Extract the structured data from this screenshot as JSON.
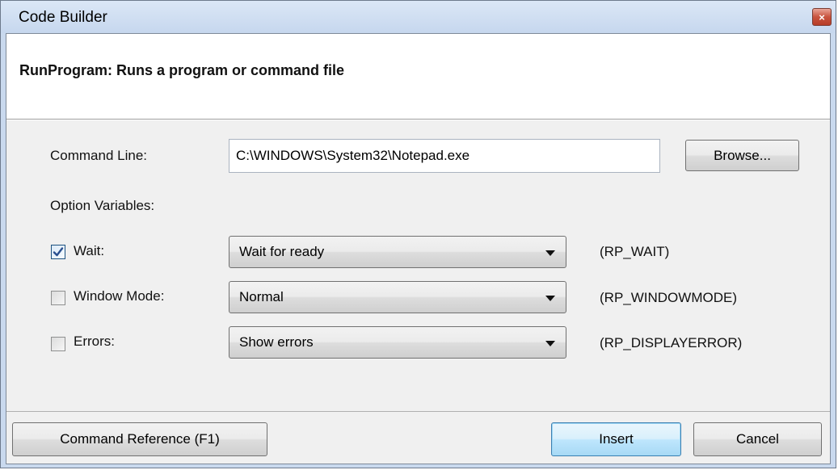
{
  "window": {
    "title": "Code Builder",
    "close_glyph": "×"
  },
  "header": {
    "description": "RunProgram: Runs a program or command file"
  },
  "command_line": {
    "label": "Command Line:",
    "value": "C:\\WINDOWS\\System32\\Notepad.exe",
    "browse_label": "Browse..."
  },
  "options": {
    "heading": "Option Variables:",
    "rows": [
      {
        "label": "Wait:",
        "checked": true,
        "selected": "Wait for ready",
        "variable": "(RP_WAIT)"
      },
      {
        "label": "Window Mode:",
        "checked": false,
        "selected": "Normal",
        "variable": "(RP_WINDOWMODE)"
      },
      {
        "label": "Errors:",
        "checked": false,
        "selected": "Show errors",
        "variable": "(RP_DISPLAYERROR)"
      }
    ]
  },
  "footer": {
    "reference_label": "Command Reference (F1)",
    "insert_label": "Insert",
    "cancel_label": "Cancel"
  },
  "icons": {
    "checkmark": "checkmark-icon",
    "dropdown": "chevron-down-icon",
    "close": "close-icon"
  }
}
